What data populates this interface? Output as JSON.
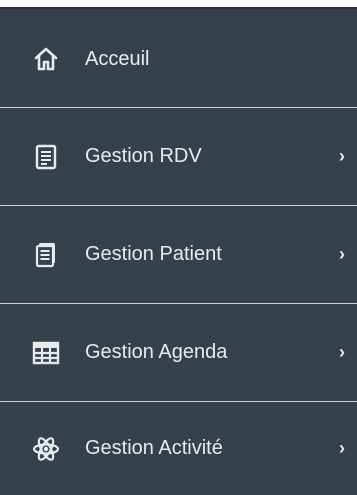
{
  "menu": {
    "items": [
      {
        "label": "Acceuil",
        "icon": "home-icon",
        "chevron": ""
      },
      {
        "label": "Gestion RDV",
        "icon": "document-icon",
        "chevron": "›"
      },
      {
        "label": "Gestion Patient",
        "icon": "documents-icon",
        "chevron": "›"
      },
      {
        "label": "Gestion Agenda",
        "icon": "table-grid-icon",
        "chevron": "›"
      },
      {
        "label": "Gestion Activité",
        "icon": "atom-icon",
        "chevron": "›"
      }
    ]
  },
  "colors": {
    "background": "#36404b",
    "text": "#e8ebee",
    "separator": "#c9d0d6"
  }
}
